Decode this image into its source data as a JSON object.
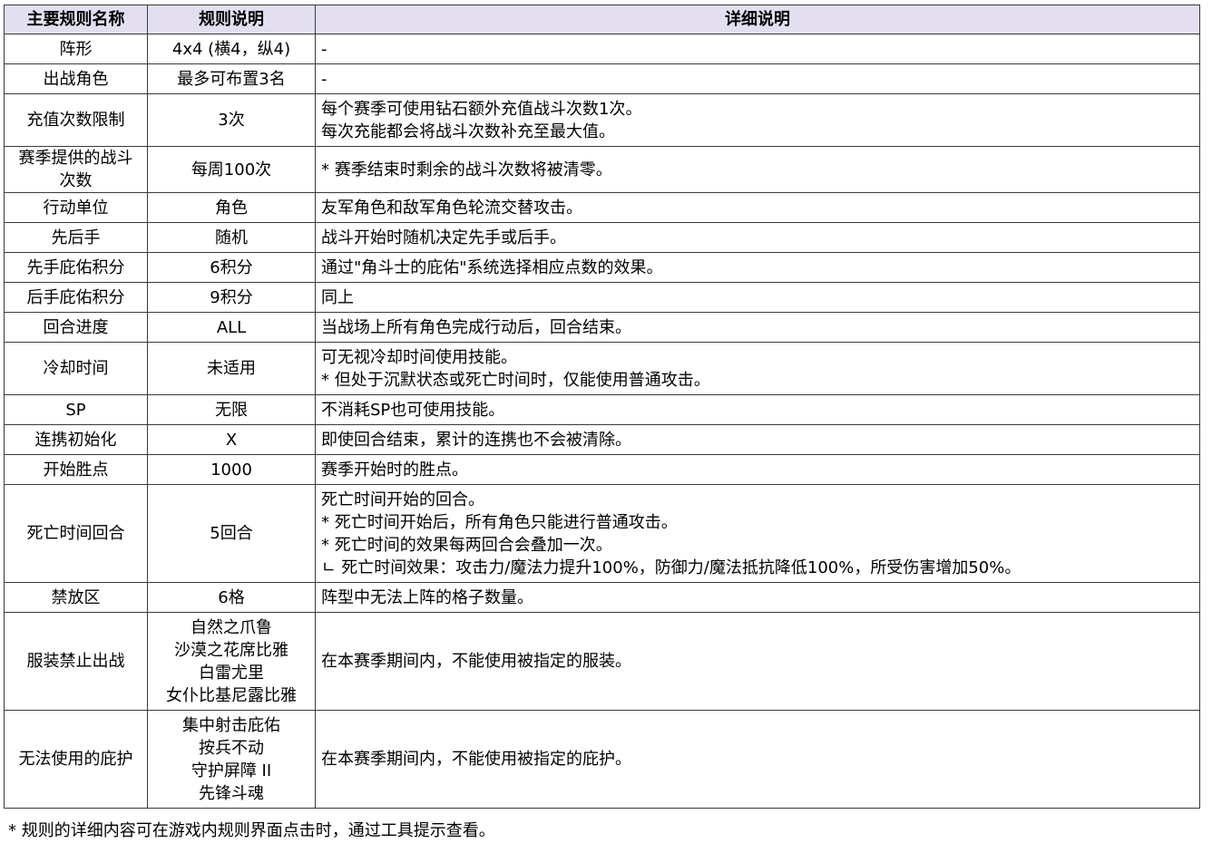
{
  "table": {
    "headers": {
      "name": "主要规则名称",
      "rule": "规则说明",
      "detail": "详细说明"
    },
    "rows": [
      {
        "name": [
          "阵形"
        ],
        "rule": [
          "4x4 (横4，纵4)"
        ],
        "detail": [
          "-"
        ]
      },
      {
        "name": [
          "出战角色"
        ],
        "rule": [
          "最多可布置3名"
        ],
        "detail": [
          "-"
        ]
      },
      {
        "name": [
          "充值次数限制"
        ],
        "rule": [
          "3次"
        ],
        "detail": [
          "每个赛季可使用钻石额外充值战斗次数1次。",
          "每次充能都会将战斗次数补充至最大值。"
        ]
      },
      {
        "name": [
          "赛季提供的战斗",
          "次数"
        ],
        "rule": [
          "每周100次"
        ],
        "detail": [
          "* 赛季结束时剩余的战斗次数将被清零。"
        ]
      },
      {
        "name": [
          "行动单位"
        ],
        "rule": [
          "角色"
        ],
        "detail": [
          "友军角色和敌军角色轮流交替攻击。"
        ]
      },
      {
        "name": [
          "先后手"
        ],
        "rule": [
          "随机"
        ],
        "detail": [
          "战斗开始时随机决定先手或后手。"
        ]
      },
      {
        "name": [
          "先手庇佑积分"
        ],
        "rule": [
          "6积分"
        ],
        "detail": [
          "通过\"角斗士的庇佑\"系统选择相应点数的效果。"
        ]
      },
      {
        "name": [
          "后手庇佑积分"
        ],
        "rule": [
          "9积分"
        ],
        "detail": [
          "同上"
        ]
      },
      {
        "name": [
          "回合进度"
        ],
        "rule": [
          "ALL"
        ],
        "detail": [
          "当战场上所有角色完成行动后，回合结束。"
        ]
      },
      {
        "name": [
          "冷却时间"
        ],
        "rule": [
          "未适用"
        ],
        "detail": [
          "可无视冷却时间使用技能。",
          "* 但处于沉默状态或死亡时间时，仅能使用普通攻击。"
        ]
      },
      {
        "name": [
          "SP"
        ],
        "rule": [
          "无限"
        ],
        "detail": [
          "不消耗SP也可使用技能。"
        ]
      },
      {
        "name": [
          "连携初始化"
        ],
        "rule": [
          "X"
        ],
        "detail": [
          "即使回合结束，累计的连携也不会被清除。"
        ]
      },
      {
        "name": [
          "开始胜点"
        ],
        "rule": [
          "1000"
        ],
        "detail": [
          "赛季开始时的胜点。"
        ]
      },
      {
        "name": [
          "死亡时间回合"
        ],
        "rule": [
          "5回合"
        ],
        "detail": [
          "死亡时间开始的回合。",
          "* 死亡时间开始后，所有角色只能进行普通攻击。",
          "* 死亡时间的效果每两回合会叠加一次。",
          "ㄴ 死亡时间效果：攻击力/魔法力提升100%，防御力/魔法抵抗降低100%，所受伤害增加50%。"
        ]
      },
      {
        "name": [
          "禁放区"
        ],
        "rule": [
          "6格"
        ],
        "detail": [
          "阵型中无法上阵的格子数量。"
        ]
      },
      {
        "name": [
          "服装禁止出战"
        ],
        "rule": [
          "自然之爪鲁",
          "沙漠之花席比雅",
          "白雷尤里",
          "女仆比基尼露比雅"
        ],
        "detail": [
          "在本赛季期间内，不能使用被指定的服装。"
        ]
      },
      {
        "name": [
          "无法使用的庇护"
        ],
        "rule": [
          "集中射击庇佑",
          "按兵不动",
          "守护屏障 II",
          "先锋斗魂"
        ],
        "detail": [
          "在本赛季期间内，不能使用被指定的庇护。"
        ]
      }
    ]
  },
  "footnote": "* 规则的详细内容可在游戏内规则界面点击时，通过工具提示查看。",
  "colors": {
    "header_bg": "#e3dff0",
    "border": "#3a3a3a"
  }
}
